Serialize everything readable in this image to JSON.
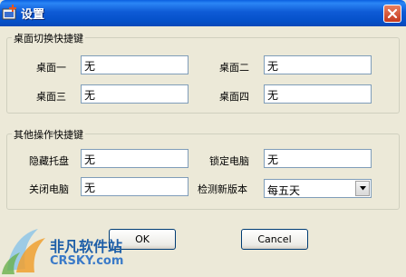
{
  "window": {
    "title": "设置"
  },
  "desktop_group": {
    "legend": "桌面切换快捷键",
    "fields": [
      {
        "label": "桌面一",
        "value": "无"
      },
      {
        "label": "桌面二",
        "value": "无"
      },
      {
        "label": "桌面三",
        "value": "无"
      },
      {
        "label": "桌面四",
        "value": "无"
      }
    ]
  },
  "other_group": {
    "legend": "其他操作快捷键",
    "hide_tray": {
      "label": "隐藏托盘",
      "value": "无"
    },
    "lock_pc": {
      "label": "锁定电脑",
      "value": "无"
    },
    "shutdown": {
      "label": "关闭电脑",
      "value": "无"
    },
    "check_update": {
      "label": "检测新版本",
      "selected": "每五天"
    }
  },
  "buttons": {
    "ok": "OK",
    "cancel": "Cancel"
  },
  "watermark": {
    "cn": "非凡软件站",
    "en": "CRSKY.com"
  },
  "colors": {
    "titlebar": "#0550c9",
    "dialog": "#ece9d8",
    "input_border": "#7f9db9"
  }
}
